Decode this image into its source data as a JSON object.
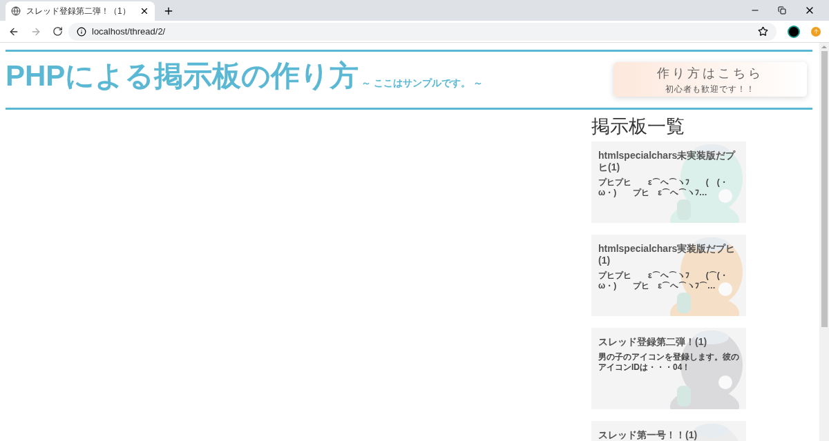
{
  "browser": {
    "tab_title": "スレッド登録第二弾！（1）",
    "url": "localhost/thread/2/"
  },
  "header": {
    "title": "PHPによる掲示板の作り方",
    "subtitle": "～ ここはサンプルです。 ～"
  },
  "guide_button": {
    "label": "作り方はこちら",
    "caption": "初心者も歓迎です！！"
  },
  "sidebar": {
    "heading": "掲示板一覧",
    "threads": [
      {
        "title": "htmlspecialchars未実装版だプヒ(1)",
        "body": "プヒプヒ　　ε⌒ヘ⌒ヽﾌ　　(　(・ω・)　　プヒ　ε⌒ヘ⌒ヽﾌ…"
      },
      {
        "title": "htmlspecialchars実装版だプヒ(1)",
        "body": "プヒプヒ　　ε⌒ヘ⌒ヽﾌ　　(⌒(・ω・)　　プヒ　ε⌒ヘ⌒ヽﾌ⌒…"
      },
      {
        "title": "スレッド登録第二弾！(1)",
        "body": "男の子のアイコンを登録します。彼のアイコンIDは・・・04！"
      },
      {
        "title": "スレッド第一号！！(1)"
      }
    ]
  }
}
